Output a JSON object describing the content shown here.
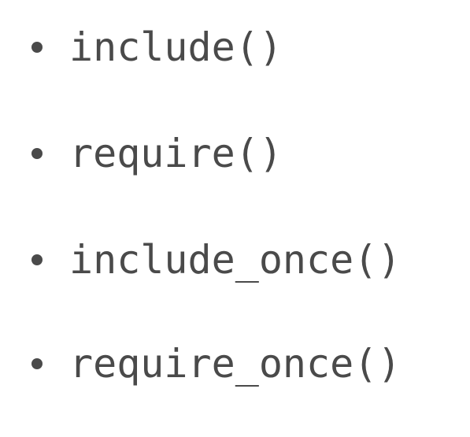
{
  "list": {
    "items": [
      {
        "label": "include()",
        "icon": "bullet-dot"
      },
      {
        "label": "require()",
        "icon": "bullet-dot"
      },
      {
        "label": "include_once()",
        "icon": "bullet-dot"
      },
      {
        "label": "require_once()",
        "icon": "bullet-dot"
      }
    ]
  },
  "colors": {
    "text": "#4a4a4a",
    "background": "#ffffff"
  }
}
